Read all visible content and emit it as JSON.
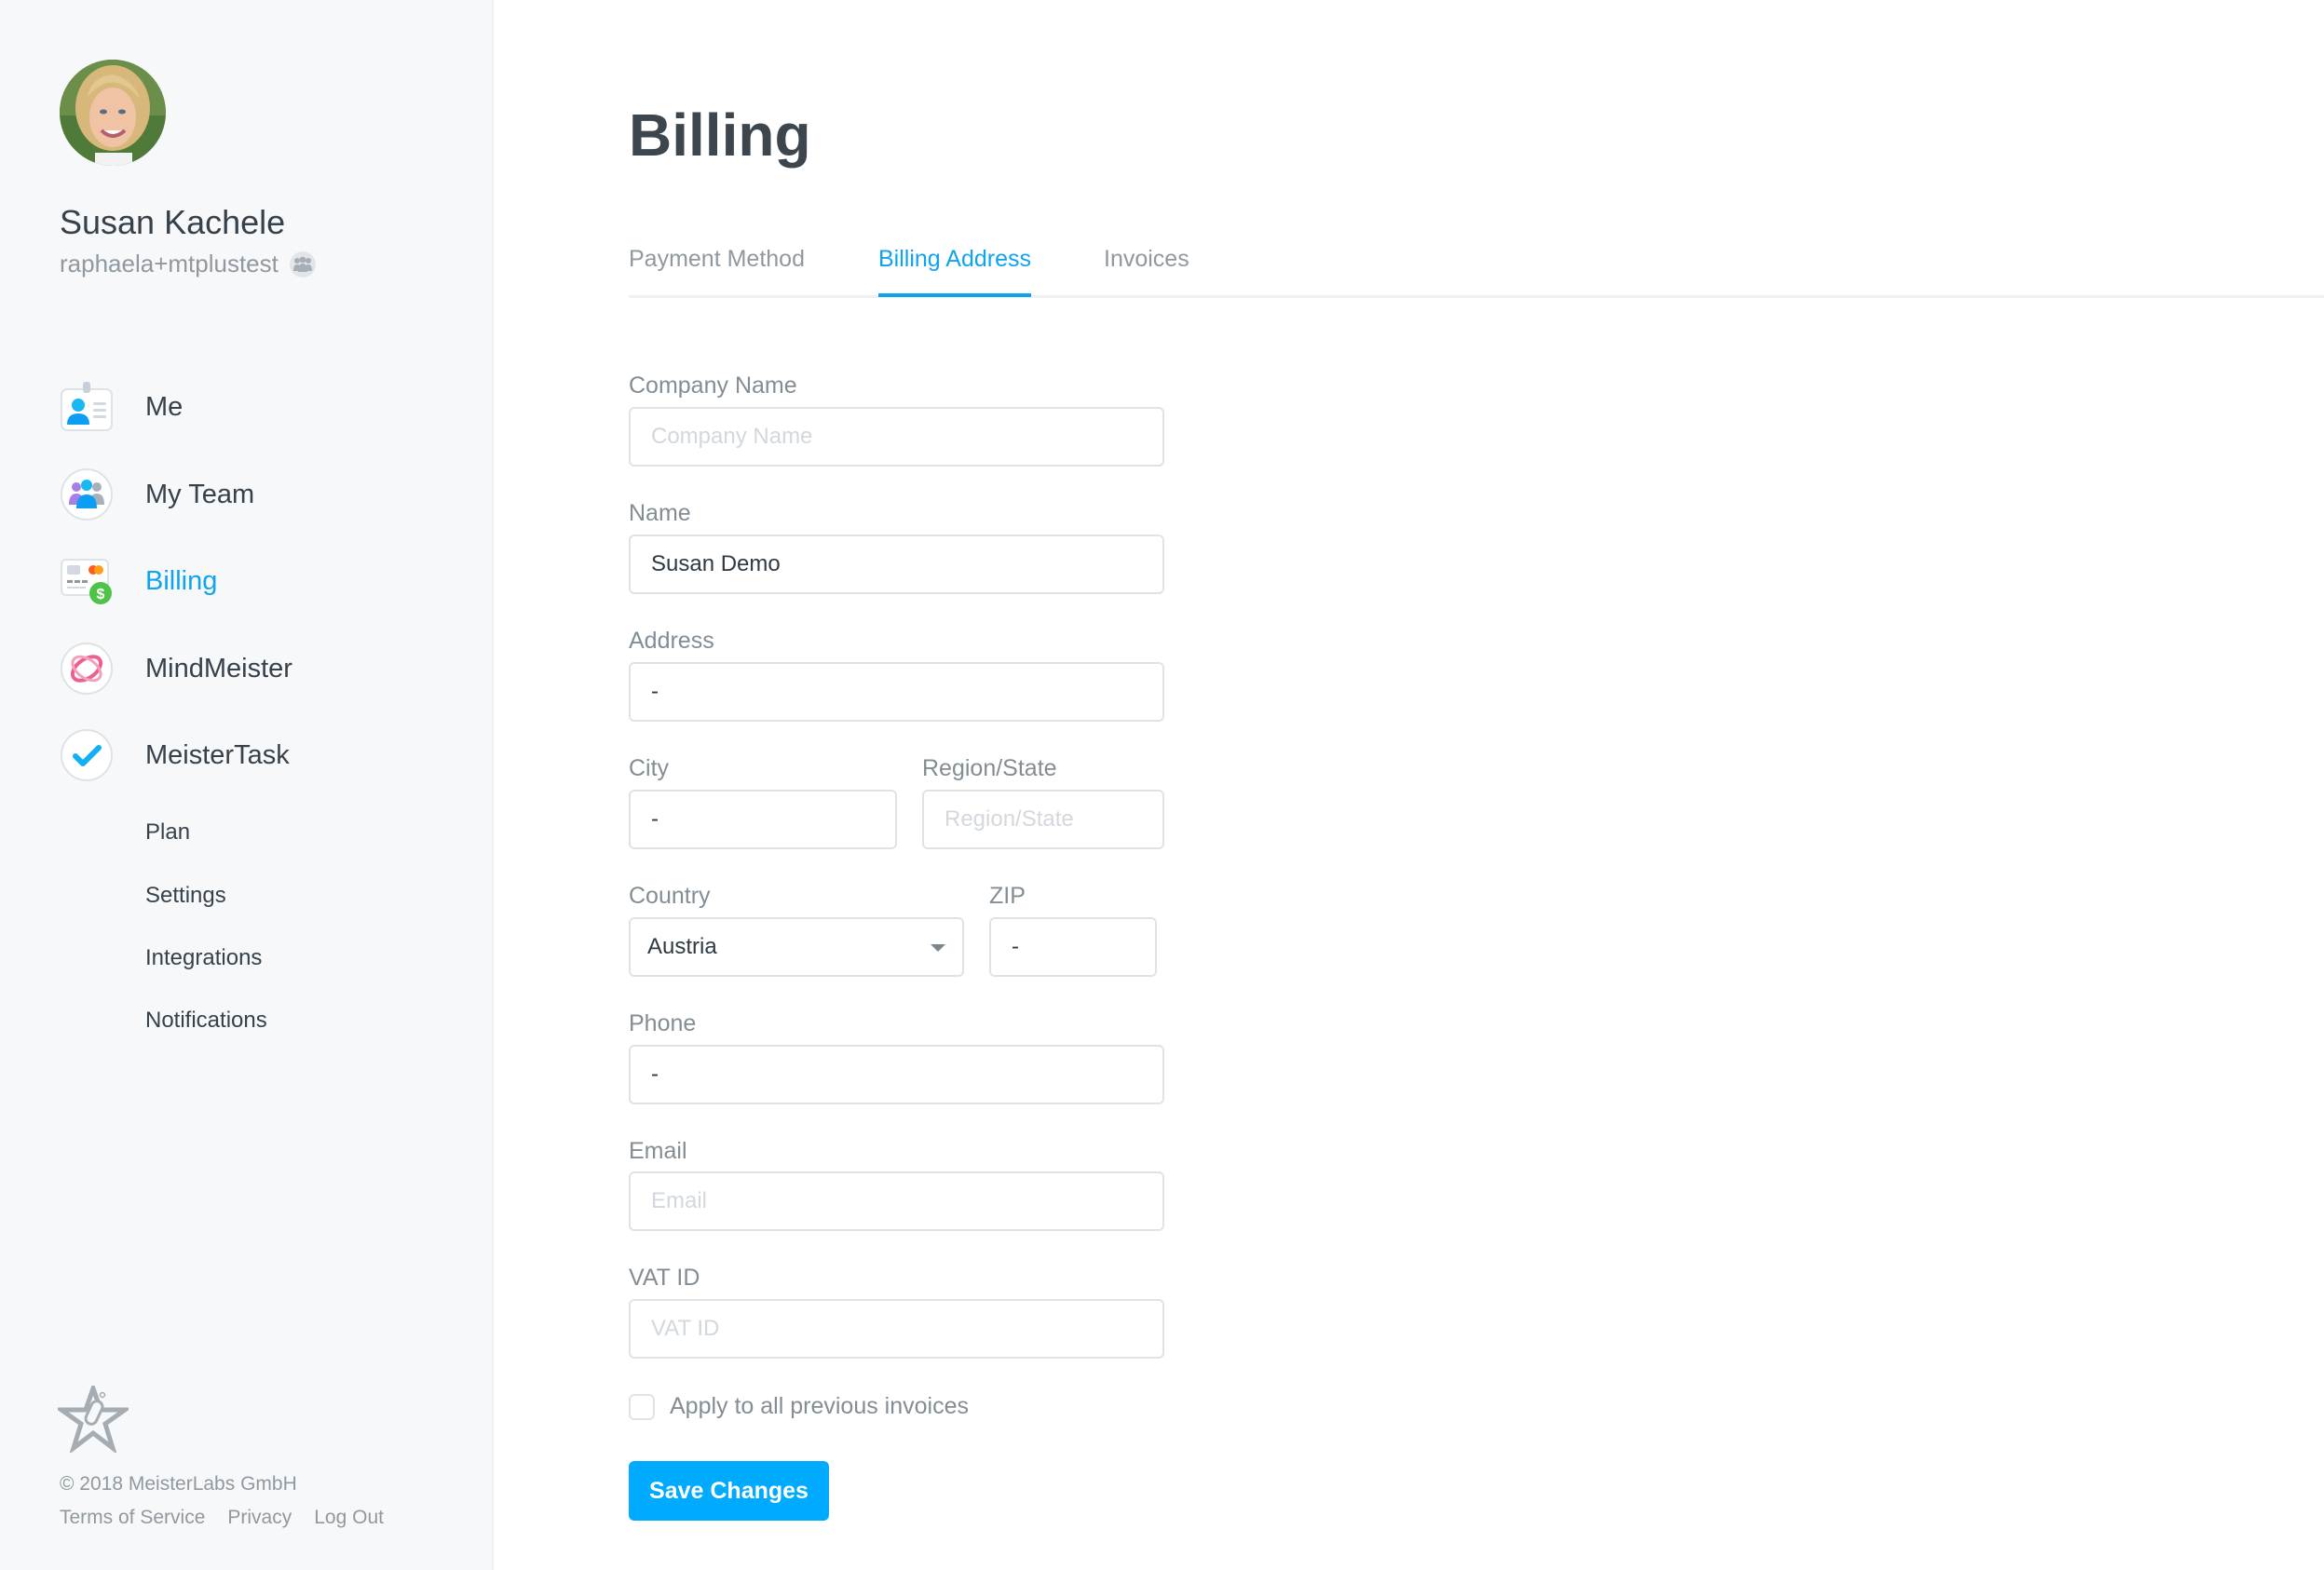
{
  "user": {
    "name": "Susan Kachele",
    "handle": "raphaela+mtplustest"
  },
  "sidebar": {
    "nav": [
      {
        "label": "Me",
        "icon": "id-badge-icon"
      },
      {
        "label": "My Team",
        "icon": "team-icon"
      },
      {
        "label": "Billing",
        "icon": "billing-card-icon",
        "active": true
      },
      {
        "label": "MindMeister",
        "icon": "mindmeister-logo-icon"
      },
      {
        "label": "MeisterTask",
        "icon": "meistertask-check-icon"
      }
    ],
    "sub_items": [
      {
        "label": "Plan"
      },
      {
        "label": "Settings"
      },
      {
        "label": "Integrations"
      },
      {
        "label": "Notifications"
      }
    ],
    "footer": {
      "copyright": "© 2018 MeisterLabs GmbH",
      "links": [
        "Terms of Service",
        "Privacy",
        "Log Out"
      ]
    }
  },
  "main": {
    "title": "Billing",
    "tabs": [
      {
        "label": "Payment Method"
      },
      {
        "label": "Billing Address",
        "active": true
      },
      {
        "label": "Invoices"
      }
    ],
    "form": {
      "company_name": {
        "label": "Company Name",
        "value": "",
        "placeholder": "Company Name"
      },
      "name": {
        "label": "Name",
        "value": "Susan Demo",
        "placeholder": ""
      },
      "address": {
        "label": "Address",
        "value": "-",
        "placeholder": ""
      },
      "city": {
        "label": "City",
        "value": "-",
        "placeholder": ""
      },
      "region": {
        "label": "Region/State",
        "value": "",
        "placeholder": "Region/State"
      },
      "country": {
        "label": "Country",
        "value": "Austria"
      },
      "zip": {
        "label": "ZIP",
        "value": "-",
        "placeholder": ""
      },
      "phone": {
        "label": "Phone",
        "value": "-",
        "placeholder": ""
      },
      "email": {
        "label": "Email",
        "value": "",
        "placeholder": "Email"
      },
      "vat_id": {
        "label": "VAT ID",
        "value": "",
        "placeholder": "VAT ID"
      },
      "apply_previous": {
        "label": "Apply to all previous invoices",
        "checked": false
      },
      "save_label": "Save Changes"
    }
  },
  "colors": {
    "accent": "#0fa3f0",
    "button": "#00aaff",
    "sidebar_bg": "#f7f8fa",
    "text_dark": "#3d464d",
    "text_muted": "#8f999f"
  }
}
